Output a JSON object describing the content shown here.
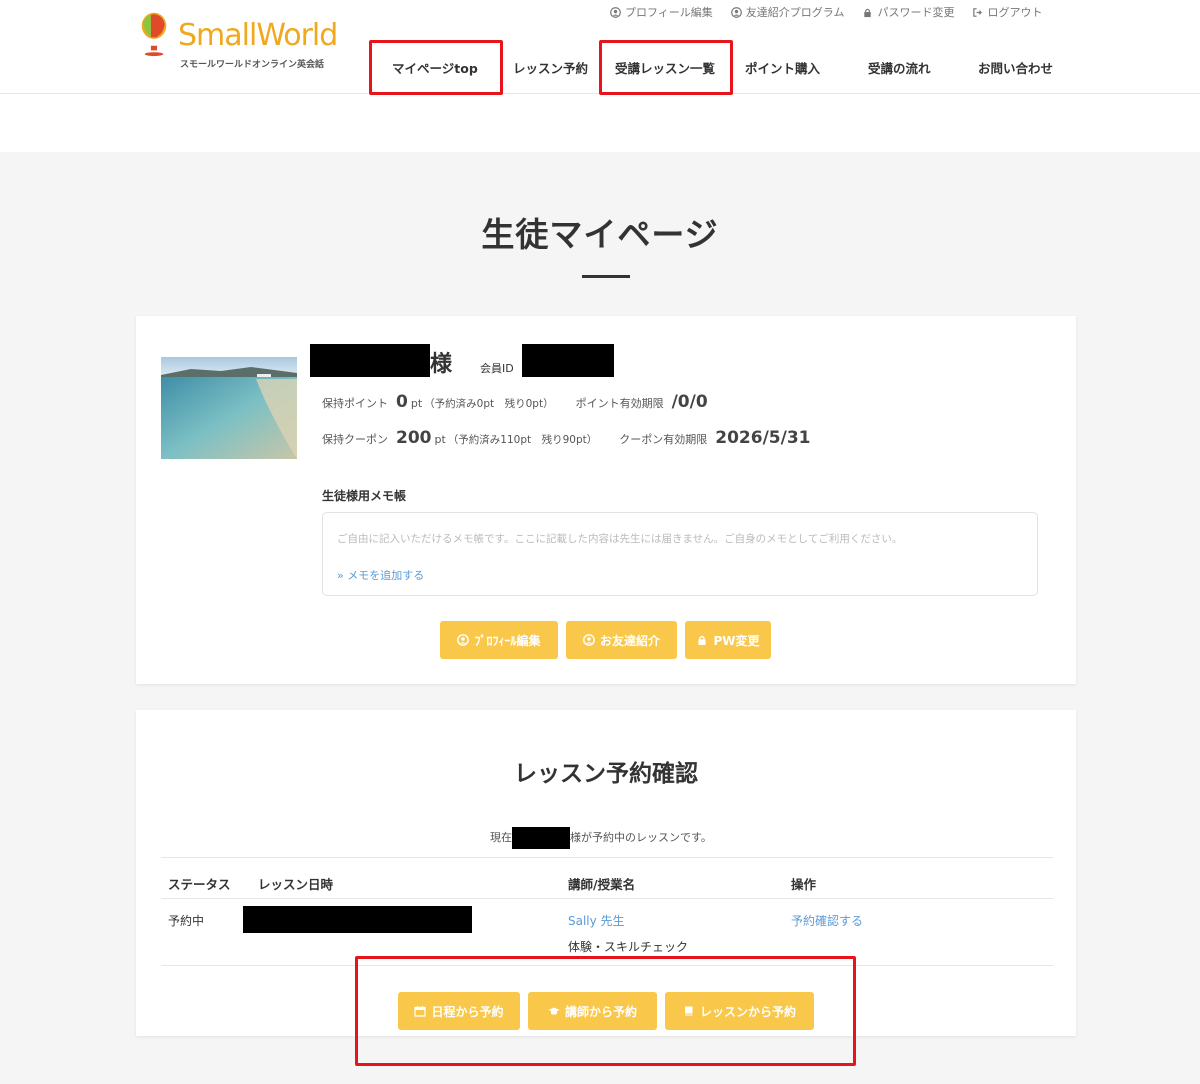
{
  "brand": {
    "name": "SmallWorld",
    "subtitle": "スモールワールドオンライン英会話"
  },
  "util_links": [
    {
      "label": "プロフィール編集",
      "icon": "user-circle-icon"
    },
    {
      "label": "友達紹介プログラム",
      "icon": "user-circle-icon"
    },
    {
      "label": "パスワード変更",
      "icon": "lock-icon"
    },
    {
      "label": "ログアウト",
      "icon": "logout-icon"
    }
  ],
  "nav": [
    {
      "label": "マイページtop"
    },
    {
      "label": "レッスン予約"
    },
    {
      "label": "受講レッスン一覧"
    },
    {
      "label": "ポイント購入"
    },
    {
      "label": "受講の流れ"
    },
    {
      "label": "お問い合わせ"
    }
  ],
  "page": {
    "title": "生徒マイページ"
  },
  "profile": {
    "name_suffix": "様",
    "member_id_label": "会員ID",
    "points_label": "保持ポイント",
    "points_value": "0",
    "points_unit": "pt",
    "points_note": "（予約済み0pt　残り0pt）",
    "points_expiry_label": "ポイント有効期限",
    "points_expiry_value": "/0/0",
    "coupon_label": "保持クーポン",
    "coupon_value": "200",
    "coupon_unit": "pt",
    "coupon_note": "（予約済み110pt　残り90pt）",
    "coupon_expiry_label": "クーポン有効期限",
    "coupon_expiry_value": "2026/5/31"
  },
  "memo": {
    "title": "生徒様用メモ帳",
    "placeholder": "ご自由に記入いただけるメモ帳です。ここに記載した内容は先生には届きません。ご自身のメモとしてご利用ください。",
    "add_link": "» メモを追加する"
  },
  "profile_buttons": [
    {
      "label": "ﾌﾟﾛﾌｨｰﾙ編集",
      "icon": "user-circle-icon"
    },
    {
      "label": "お友達紹介",
      "icon": "user-circle-icon"
    },
    {
      "label": "PW変更",
      "icon": "lock-icon"
    }
  ],
  "reservations": {
    "title": "レッスン予約確認",
    "current_prefix": "現在",
    "current_suffix": "様が予約中のレッスンです。",
    "headers": [
      "ステータス",
      "レッスン日時",
      "講師/授業名",
      "操作"
    ],
    "rows": [
      {
        "status": "予約中",
        "teacher": "Sally 先生",
        "lesson": "体験・スキルチェック",
        "action": "予約確認する"
      }
    ]
  },
  "booking_buttons": [
    {
      "label": "日程から予約",
      "icon": "calendar-icon"
    },
    {
      "label": "講師から予約",
      "icon": "graduation-cap-icon"
    },
    {
      "label": "レッスンから予約",
      "icon": "book-icon"
    }
  ],
  "colors": {
    "accent": "#f9c84a",
    "highlight": "#e8141b",
    "link": "#5b9bd5",
    "logo": "#f0a91e"
  }
}
